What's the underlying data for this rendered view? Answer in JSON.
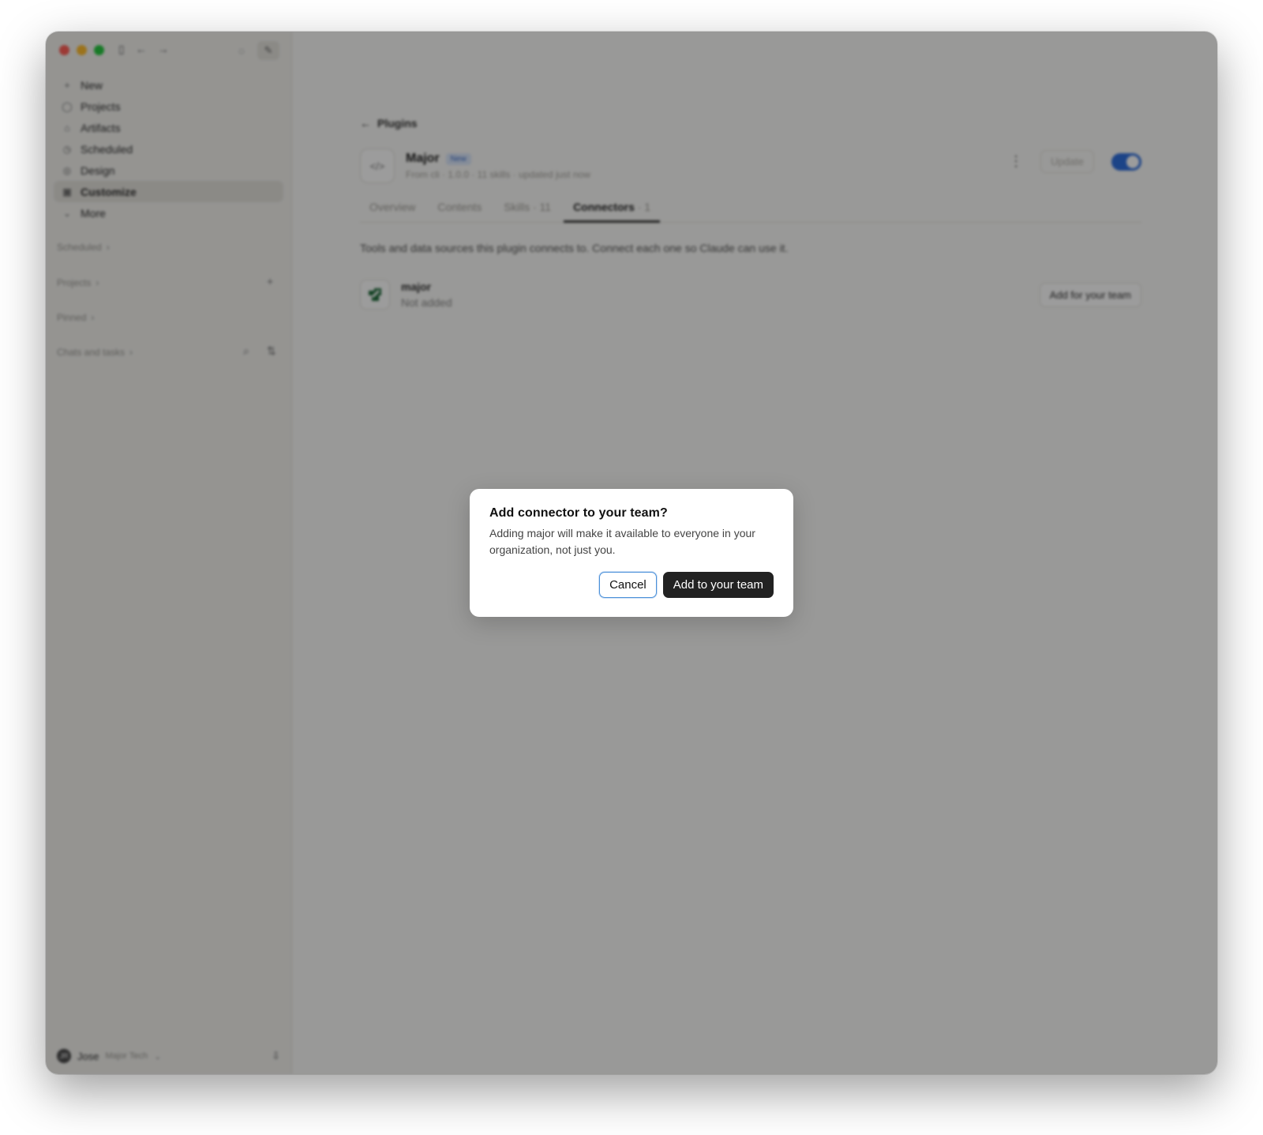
{
  "sidebar": {
    "nav": [
      {
        "label": "New",
        "icon": "plus-icon"
      },
      {
        "label": "Projects",
        "icon": "folder-icon"
      },
      {
        "label": "Artifacts",
        "icon": "artifacts-icon"
      },
      {
        "label": "Scheduled",
        "icon": "clock-icon"
      },
      {
        "label": "Design",
        "icon": "design-icon"
      },
      {
        "label": "Customize",
        "icon": "customize-icon",
        "selected": true
      },
      {
        "label": "More",
        "icon": "chevron-down-icon"
      }
    ],
    "sections": {
      "scheduled": "Scheduled",
      "projects": "Projects",
      "pinned": "Pinned",
      "chats": "Chats and tasks"
    },
    "user": {
      "initials": "JR",
      "name": "Jose",
      "org": "Major Tech"
    }
  },
  "main": {
    "back_label": "Plugins",
    "plugin": {
      "name": "Major",
      "badge": "New",
      "meta": "From cli · 1.0.0 · 11 skills · updated just now",
      "update_label": "Update",
      "enabled": true
    },
    "tabs": [
      {
        "label": "Overview",
        "count": ""
      },
      {
        "label": "Contents",
        "count": ""
      },
      {
        "label": "Skills",
        "count": "· 11"
      },
      {
        "label": "Connectors",
        "count": "· 1",
        "active": true
      }
    ],
    "description": "Tools and data sources this plugin connects to. Connect each one so Claude can use it.",
    "connector": {
      "name": "major",
      "status": "Not added",
      "action_label": "Add for your team"
    }
  },
  "dialog": {
    "title": "Add connector to your team?",
    "body": "Adding major will make it available to everyone in your organization, not just you.",
    "cancel_label": "Cancel",
    "confirm_label": "Add to your team"
  },
  "colors": {
    "toggle_on": "#2f6fdd",
    "primary_button": "#222222",
    "focus_ring": "#4a90d9",
    "overlay": "rgba(0,0,0,0.39)"
  }
}
